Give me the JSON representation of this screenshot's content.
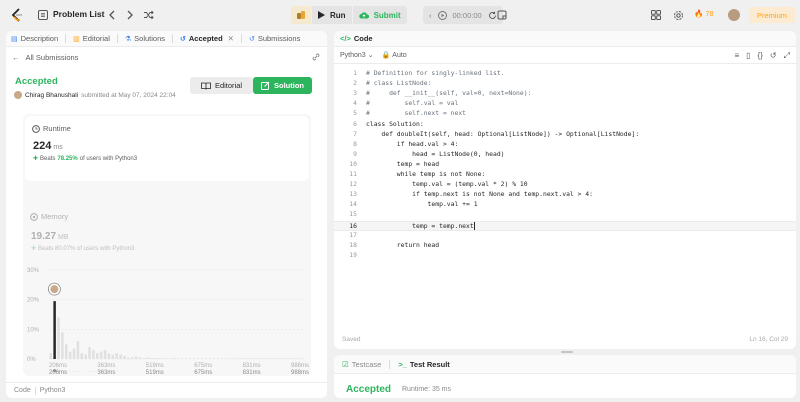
{
  "topbar": {
    "title": "Problem List",
    "run_label": "Run",
    "submit_label": "Submit",
    "timer": "00:00:00",
    "streak": "78",
    "premium_label": "Premium"
  },
  "left": {
    "tabs": [
      {
        "label": "Description"
      },
      {
        "label": "Editorial"
      },
      {
        "label": "Solutions"
      },
      {
        "label": "Accepted"
      },
      {
        "label": "Submissions"
      }
    ],
    "back_label": "All Submissions",
    "status": "Accepted",
    "submitter_name": "Chirag Bhanushali",
    "submitted_text": "submitted at May 07, 2024 22:04",
    "editorial_button": "Editorial",
    "solution_button": "Solution",
    "runtime": {
      "label": "Runtime",
      "value": "224",
      "unit": "ms",
      "beats_prefix": "Beats",
      "beats_pct": "78.25%",
      "beats_suffix": "of users with Python3"
    },
    "memory": {
      "label": "Memory",
      "value": "19.27",
      "unit": "MB",
      "beats_text": "Beats 80.07% of users with Python3"
    },
    "footer_code": "Code",
    "footer_lang": "Python3"
  },
  "chart_data": {
    "type": "bar",
    "title": "",
    "ylabel": "",
    "y_ticks": [
      "30%",
      "20%",
      "10%",
      "0%"
    ],
    "x_ticks": [
      "206ms",
      "363ms",
      "519ms",
      "675ms",
      "831ms",
      "988ms"
    ],
    "mini_x_ticks": [
      "206ms",
      "363ms",
      "519ms",
      "675ms",
      "831ms",
      "988ms"
    ],
    "ylim": [
      0,
      30
    ],
    "highlight_index": 1,
    "values": [
      2,
      19.5,
      14,
      9,
      5,
      2.5,
      3.5,
      6,
      2,
      1.5,
      4,
      3,
      2,
      2.5,
      3,
      2,
      1.5,
      2,
      1.5,
      1,
      0.5,
      0.5,
      0.8,
      0.5,
      0.3,
      0.5,
      0.3,
      0.3,
      0.3,
      0.3,
      0.2,
      0.2,
      0.3,
      0.2,
      0.2,
      0.2,
      0.2,
      0.2,
      0.2,
      0.2,
      0.2,
      0.2,
      0.2,
      0.2,
      0.2,
      0.2,
      0.2,
      0.2,
      0.2,
      0.2,
      0.2,
      0.2,
      0.2,
      0.2,
      0.2,
      0.2,
      0.2,
      0.2,
      0.2,
      0.2,
      0.2,
      0.2,
      0.2,
      0.2,
      0.2,
      0.2
    ]
  },
  "editor": {
    "tab_label": "Code",
    "language": "Python3",
    "mode": "Auto",
    "lines": [
      "# Definition for singly-linked list.",
      "# class ListNode:",
      "#     def __init__(self, val=0, next=None):",
      "#         self.val = val",
      "#         self.next = next",
      "class Solution:",
      "    def doubleIt(self, head: Optional[ListNode]) -> Optional[ListNode]:",
      "        if head.val > 4:",
      "            head = ListNode(0, head)",
      "        temp = head",
      "        while temp is not None:",
      "            temp.val = (temp.val * 2) % 10",
      "            if temp.next is not None and temp.next.val > 4:",
      "                temp.val += 1",
      "",
      "            temp = temp.next",
      "",
      "        return head",
      ""
    ],
    "cursor_line": 16,
    "saved_label": "Saved",
    "position_label": "Ln 16, Col 29"
  },
  "result": {
    "testcase_tab": "Testcase",
    "test_result_tab": "Test Result",
    "status": "Accepted",
    "runtime": "Runtime: 35 ms"
  },
  "colors": {
    "accent_green": "#2db55d",
    "accent_orange": "#ffa116"
  }
}
